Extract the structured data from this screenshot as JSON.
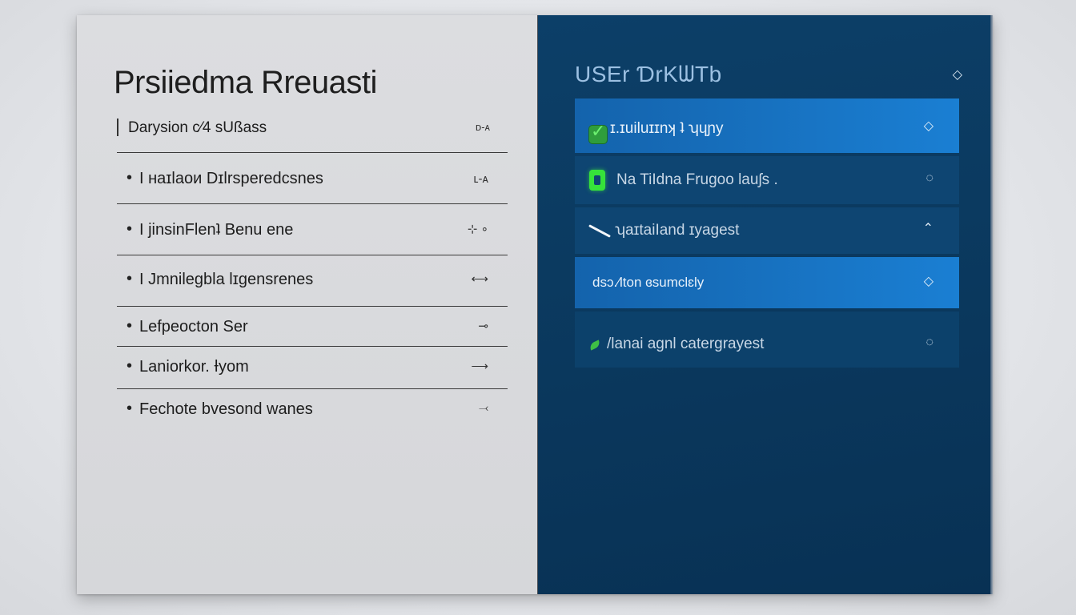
{
  "left": {
    "title": "Prsiiedma Rreuasti",
    "header": {
      "label": "Darysion c⁄4 sUßass",
      "icon": "ᴅ-ᴀ"
    },
    "items": [
      {
        "label": "I ʜaɪlaoᴎ Dɪlrsperedᴄsnes",
        "arrow": "ʟ-ᴀ"
      },
      {
        "label": "I jinsinFlenʇ Benu  ene",
        "arrow": "⊹ ∘"
      },
      {
        "label": "I Jmnilegbla Ɩɪgensrenes",
        "arrow": "⟷"
      },
      {
        "label": "Lefpeocton Ser",
        "arrow": "⊸"
      },
      {
        "label": "Laniorkor. Ɨyom",
        "arrow": "⟶"
      },
      {
        "label": "Fechote bvesond wanes",
        "arrow": "⤙"
      }
    ]
  },
  "right": {
    "title": "USEr ƊrKᗯTb",
    "title_icon": "◇",
    "items": [
      {
        "label": "ɪ.ɪuiluɪɪnʞ ʇ ʮɥɲy",
        "chevron": "◇",
        "selected": true,
        "marker": "checkbox"
      },
      {
        "label": "Na TiIdna Frugoo lauʃs .",
        "chevron": "◌",
        "selected": false,
        "marker": "green-pill"
      },
      {
        "label": "ʮaɪtaiIand ɪyagest",
        "chevron": "⌃",
        "selected": false,
        "marker": "slash"
      },
      {
        "label": "dsɔ.⁄lton ɞsumclɛly",
        "chevron": "◇",
        "selected": true,
        "marker": "none"
      },
      {
        "label": "/lanai agnl catergrayest",
        "chevron": "◌",
        "selected": false,
        "marker": "leaf"
      }
    ]
  },
  "colors": {
    "left_bg": "#dcdde0",
    "right_bg": "#0b3a60",
    "selected_bg": "#1a7fd3",
    "accent_green": "#36e23a"
  }
}
